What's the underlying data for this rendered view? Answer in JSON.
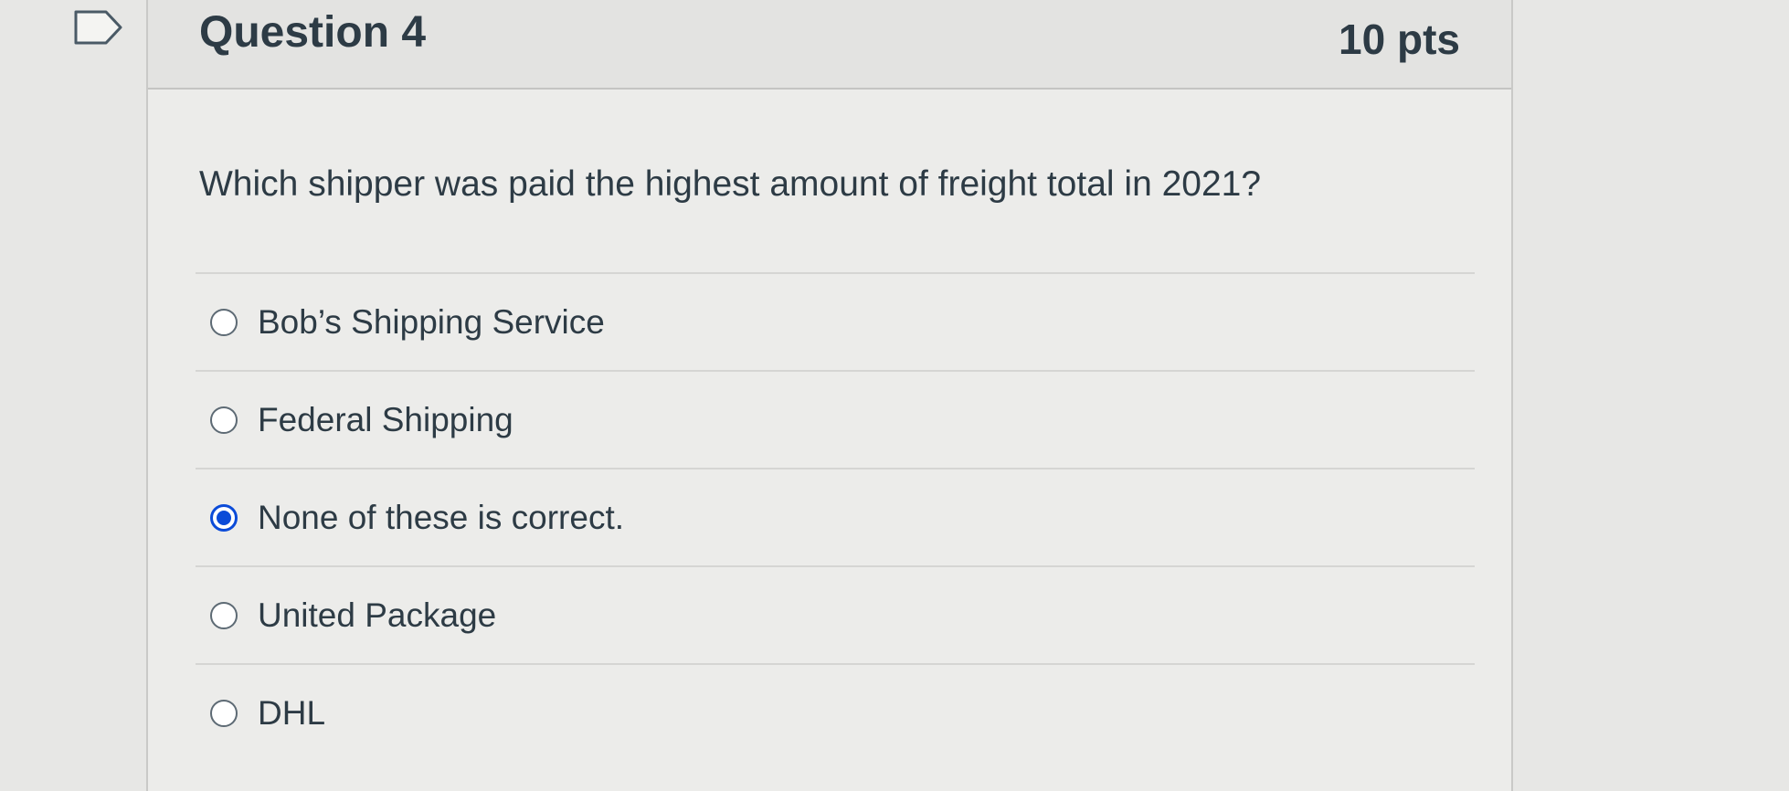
{
  "question": {
    "title": "Question 4",
    "points": "10 pts",
    "text": "Which shipper was paid the highest amount of freight total in 2021?"
  },
  "answers": [
    {
      "label": "Bob’s Shipping Service",
      "selected": false
    },
    {
      "label": "Federal Shipping",
      "selected": false
    },
    {
      "label": "None of these is correct.",
      "selected": true
    },
    {
      "label": "United Package",
      "selected": false
    },
    {
      "label": "DHL",
      "selected": false
    }
  ],
  "icons": {
    "flag": "flag-question-icon"
  },
  "colors": {
    "selected_radio": "#0b4bd8",
    "text": "#2d3b45"
  }
}
